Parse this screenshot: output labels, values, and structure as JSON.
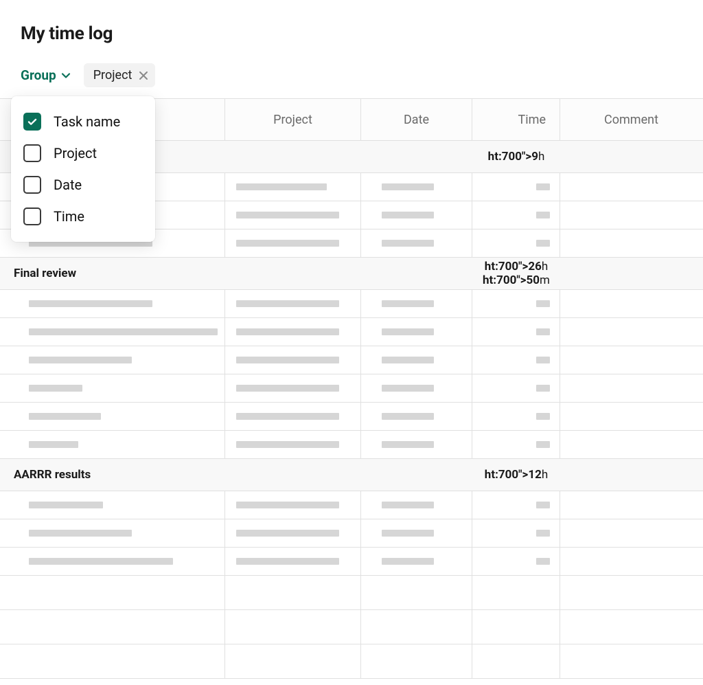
{
  "title": "My time log",
  "toolbar": {
    "group_label": "Group",
    "chip_label": "Project"
  },
  "dropdown": {
    "items": [
      {
        "label": "Task name",
        "checked": true
      },
      {
        "label": "Project",
        "checked": false
      },
      {
        "label": "Date",
        "checked": false
      },
      {
        "label": "Time",
        "checked": false
      }
    ]
  },
  "columns": {
    "task": "",
    "project": "Project",
    "date": "Date",
    "time": "Time",
    "comment": "Comment"
  },
  "groups": [
    {
      "label": "",
      "time_html": "<b>9</b>h",
      "rows": [
        {
          "task_w": 180,
          "project_w": 132,
          "date_w": 76,
          "time_w": 20
        },
        {
          "task_w": 180,
          "project_w": 150,
          "date_w": 76,
          "time_w": 20
        },
        {
          "task_w": 180,
          "project_w": 150,
          "date_w": 76,
          "time_w": 20
        }
      ]
    },
    {
      "label": "Final review",
      "time_html": "<b>26</b>h <b>50</b>m",
      "rows": [
        {
          "task_w": 180,
          "project_w": 150,
          "date_w": 76,
          "time_w": 20
        },
        {
          "task_w": 275,
          "project_w": 150,
          "date_w": 76,
          "time_w": 20
        },
        {
          "task_w": 150,
          "project_w": 150,
          "date_w": 76,
          "time_w": 20
        },
        {
          "task_w": 78,
          "project_w": 150,
          "date_w": 76,
          "time_w": 20
        },
        {
          "task_w": 105,
          "project_w": 150,
          "date_w": 76,
          "time_w": 20
        },
        {
          "task_w": 72,
          "project_w": 150,
          "date_w": 76,
          "time_w": 20
        }
      ]
    },
    {
      "label": "AARRR results",
      "time_html": "<b>12</b>h",
      "rows": [
        {
          "task_w": 108,
          "project_w": 150,
          "date_w": 76,
          "time_w": 20
        },
        {
          "task_w": 150,
          "project_w": 150,
          "date_w": 76,
          "time_w": 20
        },
        {
          "task_w": 210,
          "project_w": 150,
          "date_w": 76,
          "time_w": 20
        }
      ]
    }
  ],
  "empty_rows": 3
}
